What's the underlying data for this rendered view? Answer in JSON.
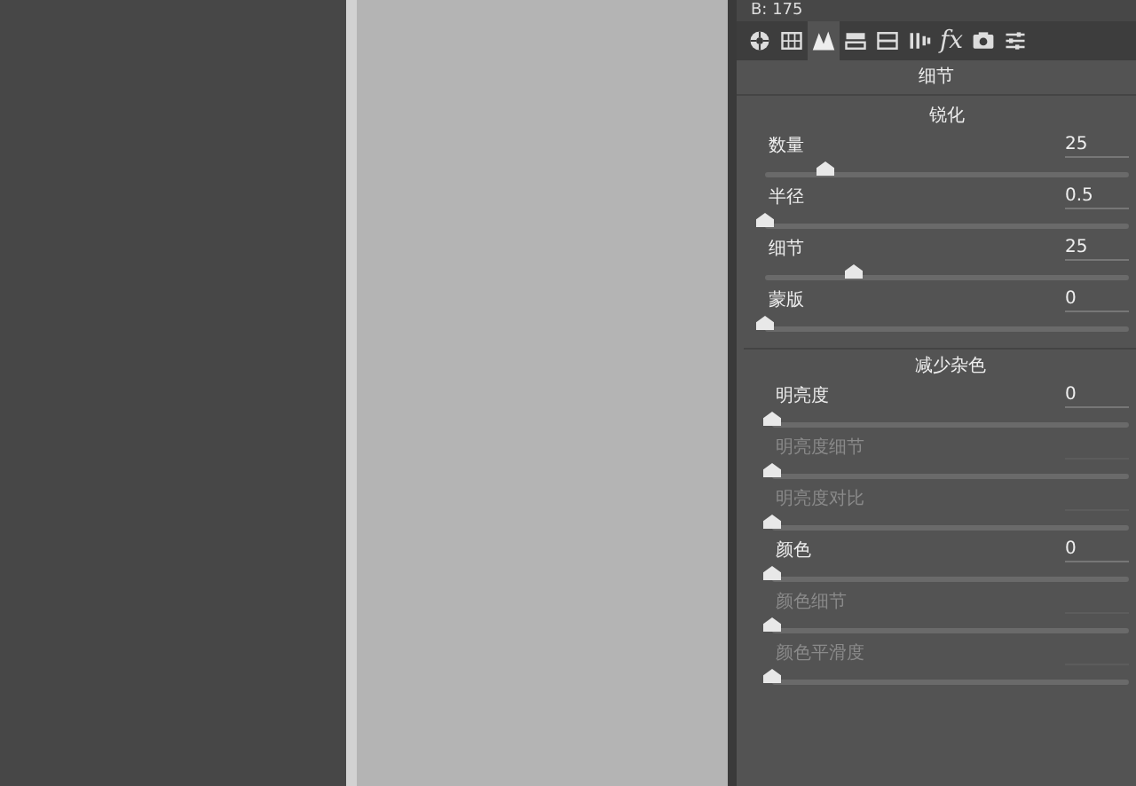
{
  "readout": "B: 175",
  "tabs": [
    {
      "selected": false
    },
    {
      "selected": false
    },
    {
      "selected": true
    },
    {
      "selected": false
    },
    {
      "selected": false
    },
    {
      "selected": false
    },
    {
      "label": "fx",
      "selected": false
    },
    {
      "selected": false
    },
    {
      "selected": false
    }
  ],
  "panel_title": "细节",
  "sections": [
    {
      "title": "锐化",
      "sliders": [
        {
          "label": "数量",
          "value": "25",
          "level": 0.17,
          "disabled": false
        },
        {
          "label": "半径",
          "value": "0.5",
          "level": 0,
          "disabled": false
        },
        {
          "label": "细节",
          "value": "25",
          "level": 0.25,
          "disabled": false
        },
        {
          "label": "蒙版",
          "value": "0",
          "level": 0,
          "disabled": false
        }
      ]
    },
    {
      "title": "减少杂色",
      "sliders": [
        {
          "label": "明亮度",
          "value": "0",
          "level": 0,
          "disabled": false
        },
        {
          "label": "明亮度细节",
          "level": 0,
          "disabled": true
        },
        {
          "label": "明亮度对比",
          "level": 0,
          "disabled": true
        },
        {
          "label": "颜色",
          "value": "0",
          "level": 0,
          "disabled": false
        },
        {
          "label": "颜色细节",
          "level": 0,
          "disabled": true
        },
        {
          "label": "颜色平滑度",
          "level": 0,
          "disabled": true
        }
      ]
    }
  ]
}
